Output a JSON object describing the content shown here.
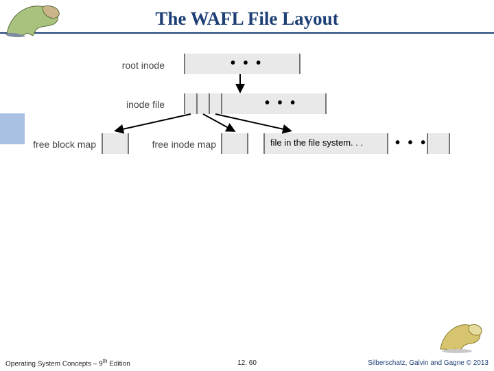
{
  "title": "The WAFL File Layout",
  "labels": {
    "root_inode": "root inode",
    "inode_file": "inode file",
    "free_block_map": "free block map",
    "free_inode_map": "free inode map",
    "file_in_fs": "file in the file system. . ."
  },
  "dots": "• • •",
  "footer": {
    "left": "Operating System Concepts – 9",
    "left_sup": "th",
    "left_tail": " Edition",
    "center": "12. 60",
    "right": "Silberschatz, Galvin and Gagne © 2013"
  },
  "icons": {
    "dino_left": "dinosaur-logo-icon",
    "dino_right": "dinosaur-logo-icon"
  }
}
